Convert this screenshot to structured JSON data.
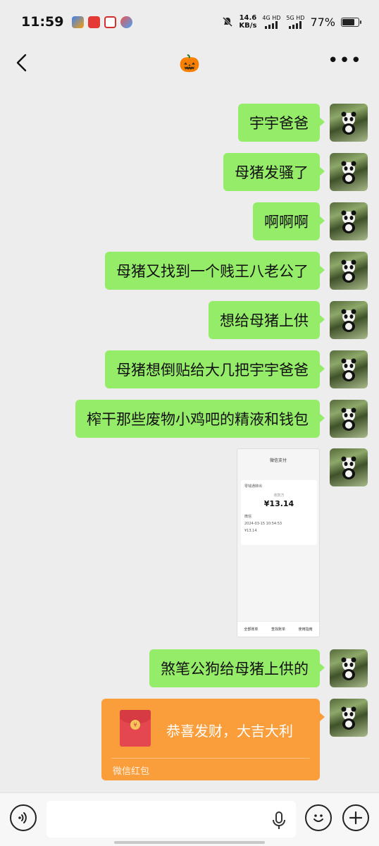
{
  "status_bar": {
    "time": "11:59",
    "net_speed_value": "14.6",
    "net_speed_unit": "KB/s",
    "sim1": "4G HD",
    "sim2": "5G HD",
    "battery_percent": "77%",
    "battery_level": 0.77,
    "app_icons": [
      "photos-app-icon",
      "shopping-app-icon",
      "gift-app-icon",
      "game-app-icon"
    ]
  },
  "header": {
    "title": "🎃",
    "back_icon": "chevron-left-icon",
    "more_icon": "more-dots-icon"
  },
  "messages": [
    {
      "type": "text",
      "text": "宇宇爸爸"
    },
    {
      "type": "text",
      "text": "母猪发骚了"
    },
    {
      "type": "text",
      "text": "啊啊啊"
    },
    {
      "type": "text",
      "text": "母猪又找到一个贱王八老公了"
    },
    {
      "type": "text",
      "text": "想给母猪上供"
    },
    {
      "type": "text",
      "text": "母猪想倒贴给大几把宇宇爸爸"
    },
    {
      "type": "text",
      "text": "榨干那些废物小鸡吧的精液和钱包"
    },
    {
      "type": "image",
      "screenshot": {
        "title": "微信支付",
        "merchant": "零钱通转出",
        "label": "收款方",
        "amount": "¥13.14",
        "row1": "微信",
        "row2": "2024-03-15 10:54:53",
        "row3": "¥13.14",
        "footer": [
          "全部账单",
          "查找账单",
          "使用指南"
        ]
      }
    },
    {
      "type": "text",
      "text": "煞笔公狗给母猪上供的"
    },
    {
      "type": "red_packet",
      "text": "恭喜发财，大吉大利",
      "footer": "微信红包"
    }
  ],
  "input_bar": {
    "voice_icon": "voice-icon",
    "input_value": "",
    "mic_icon": "mic-icon",
    "emoji_icon": "emoji-icon",
    "add_icon": "plus-icon"
  },
  "colors": {
    "chat_bg": "#ededed",
    "bubble_green": "#95ec69",
    "red_packet_orange": "#fa9d3b"
  }
}
